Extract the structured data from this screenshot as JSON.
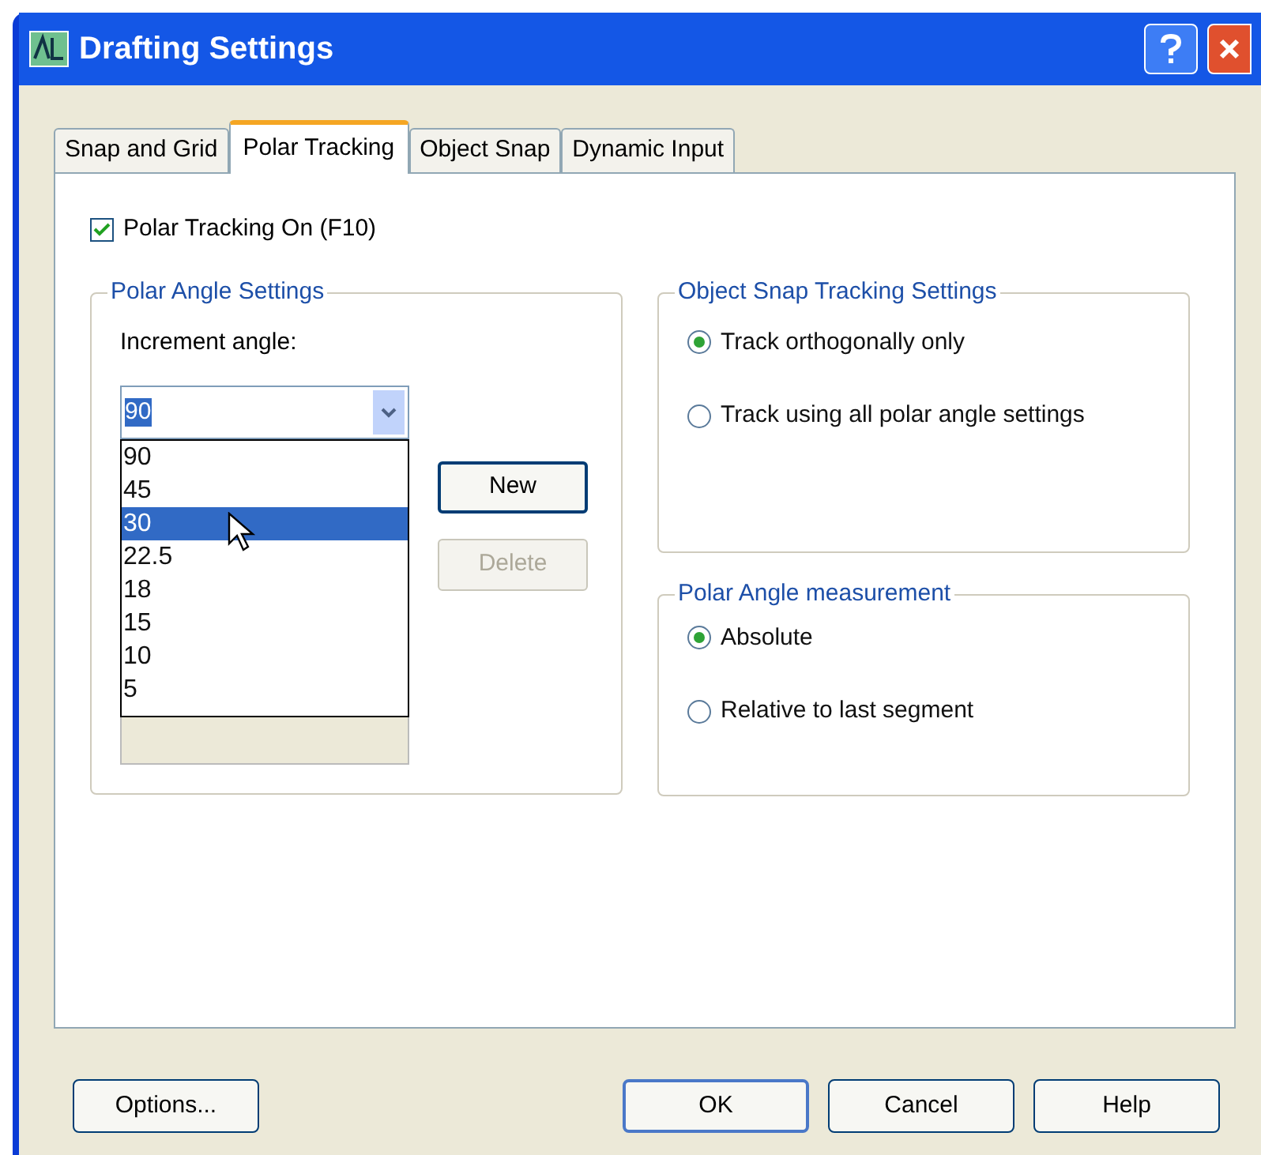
{
  "window": {
    "title": "Drafting Settings"
  },
  "tabs": [
    {
      "label": "Snap and Grid",
      "selected": false
    },
    {
      "label": "Polar Tracking",
      "selected": true
    },
    {
      "label": "Object Snap",
      "selected": false
    },
    {
      "label": "Dynamic Input",
      "selected": false
    }
  ],
  "polar_tracking_on": {
    "label": "Polar Tracking On (F10)",
    "checked": true
  },
  "polar_angle_settings": {
    "title": "Polar Angle Settings",
    "increment_label": "Increment angle:",
    "increment_value": "90",
    "options": [
      {
        "label": "90",
        "selected": false
      },
      {
        "label": "45",
        "selected": false
      },
      {
        "label": "30",
        "selected": true
      },
      {
        "label": "22.5",
        "selected": false
      },
      {
        "label": "18",
        "selected": false
      },
      {
        "label": "15",
        "selected": false
      },
      {
        "label": "10",
        "selected": false
      },
      {
        "label": "5",
        "selected": false
      }
    ],
    "buttons": [
      {
        "label": "New",
        "disabled": false
      },
      {
        "label": "Delete",
        "disabled": true
      }
    ]
  },
  "object_snap_tracking": {
    "title": "Object Snap Tracking Settings",
    "options": [
      {
        "label": "Track orthogonally only",
        "selected": true
      },
      {
        "label": "Track using all polar angle settings",
        "selected": false
      }
    ]
  },
  "polar_angle_measurement": {
    "title": "Polar Angle measurement",
    "options": [
      {
        "label": "Absolute",
        "selected": true
      },
      {
        "label": "Relative to last segment",
        "selected": false
      }
    ]
  },
  "footer_buttons": [
    {
      "label": "Options...",
      "default": false
    },
    {
      "label": "OK",
      "default": true
    },
    {
      "label": "Cancel",
      "default": false
    },
    {
      "label": "Help",
      "default": false
    }
  ]
}
